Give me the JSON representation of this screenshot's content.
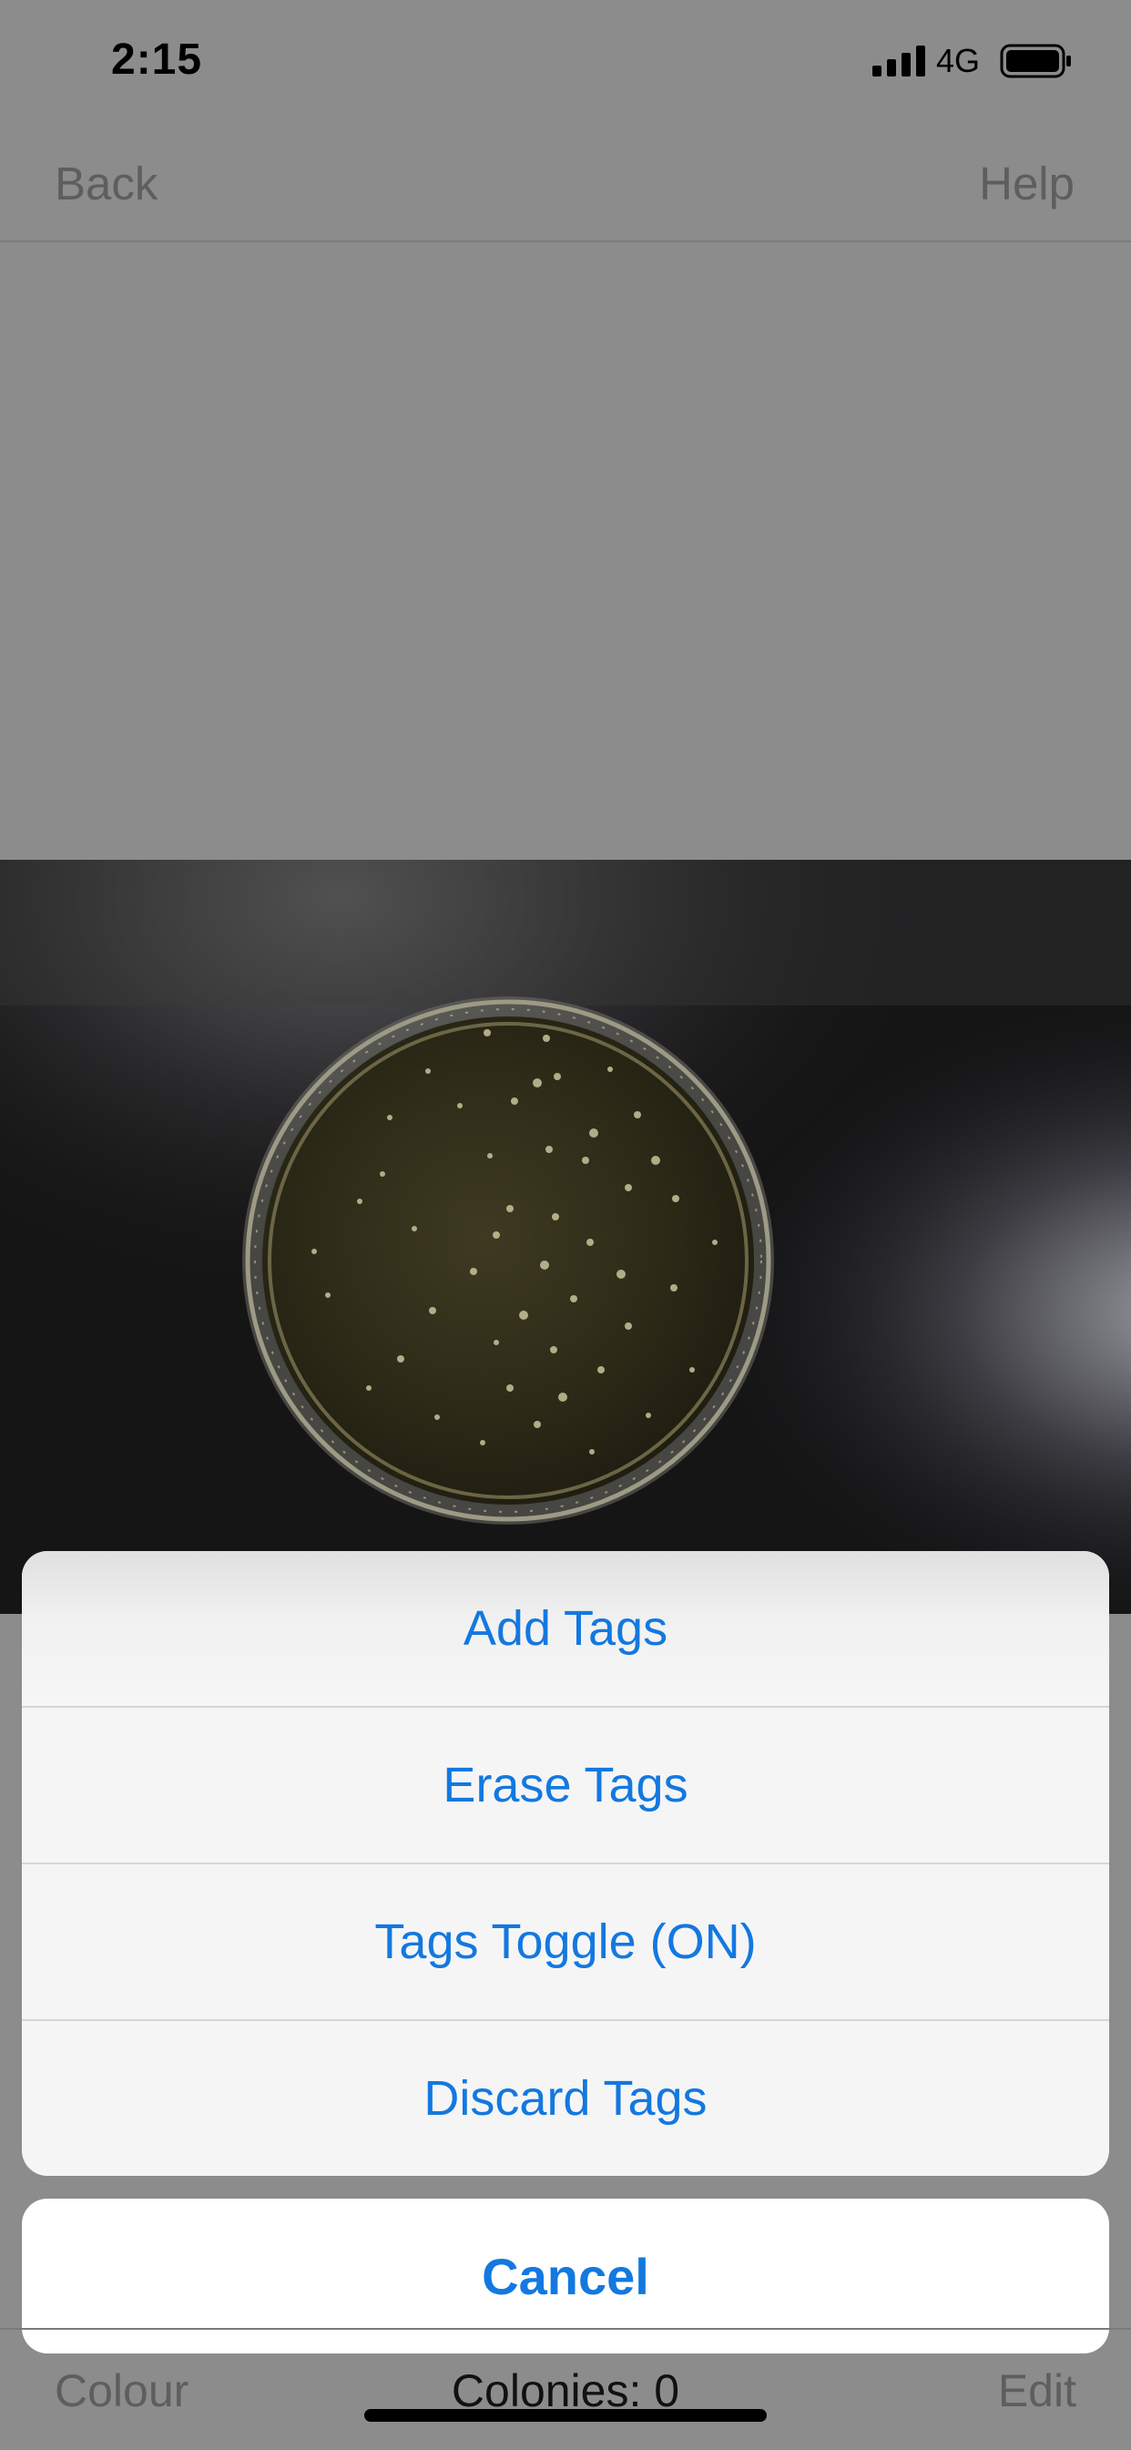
{
  "status_bar": {
    "time": "2:15",
    "network": "4G",
    "signal_icon": "cellular-signal-icon",
    "battery_icon": "battery-icon"
  },
  "nav": {
    "back_label": "Back",
    "help_label": "Help"
  },
  "photo": {
    "subject": "petri-dish-photo"
  },
  "action_sheet": {
    "options": [
      {
        "label": "Add Tags"
      },
      {
        "label": "Erase Tags"
      },
      {
        "label": "Tags Toggle (ON)"
      },
      {
        "label": "Discard Tags"
      }
    ],
    "cancel_label": "Cancel",
    "accent_color": "#1378e0"
  },
  "toolbar": {
    "colour_label": "Colour",
    "colonies_label": "Colonies: 0",
    "edit_label": "Edit"
  }
}
